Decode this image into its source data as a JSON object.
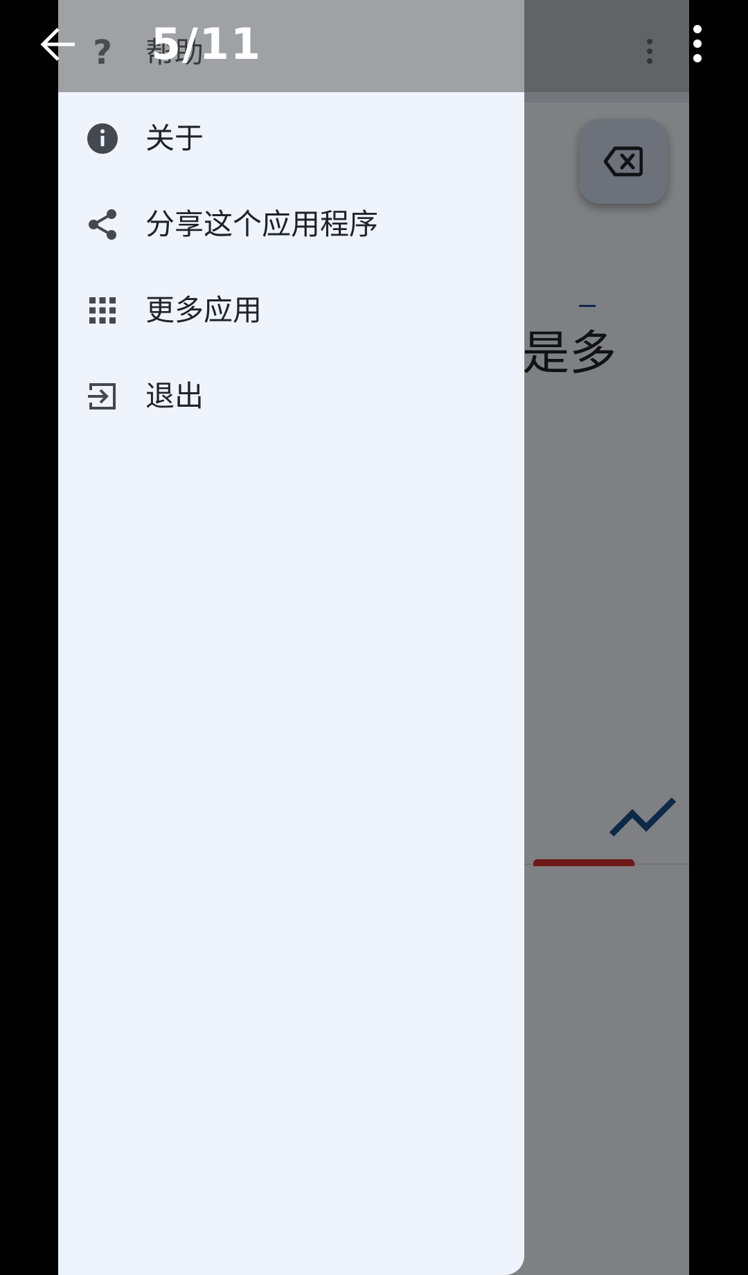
{
  "viewer": {
    "counter": "5/11"
  },
  "background": {
    "partial_text": "是多"
  },
  "drawer": {
    "items": [
      {
        "label": "帮助",
        "icon": "help-icon"
      },
      {
        "label": "关于",
        "icon": "info-icon"
      },
      {
        "label": "分享这个应用程序",
        "icon": "share-icon"
      },
      {
        "label": "更多应用",
        "icon": "apps-grid-icon"
      },
      {
        "label": "退出",
        "icon": "exit-icon"
      }
    ]
  },
  "colors": {
    "drawer_bg": "#eff3fb",
    "icon": "#444850",
    "text": "#1f2329",
    "tab_indicator": "#d32f2f",
    "trend": "#1a4f8a"
  }
}
